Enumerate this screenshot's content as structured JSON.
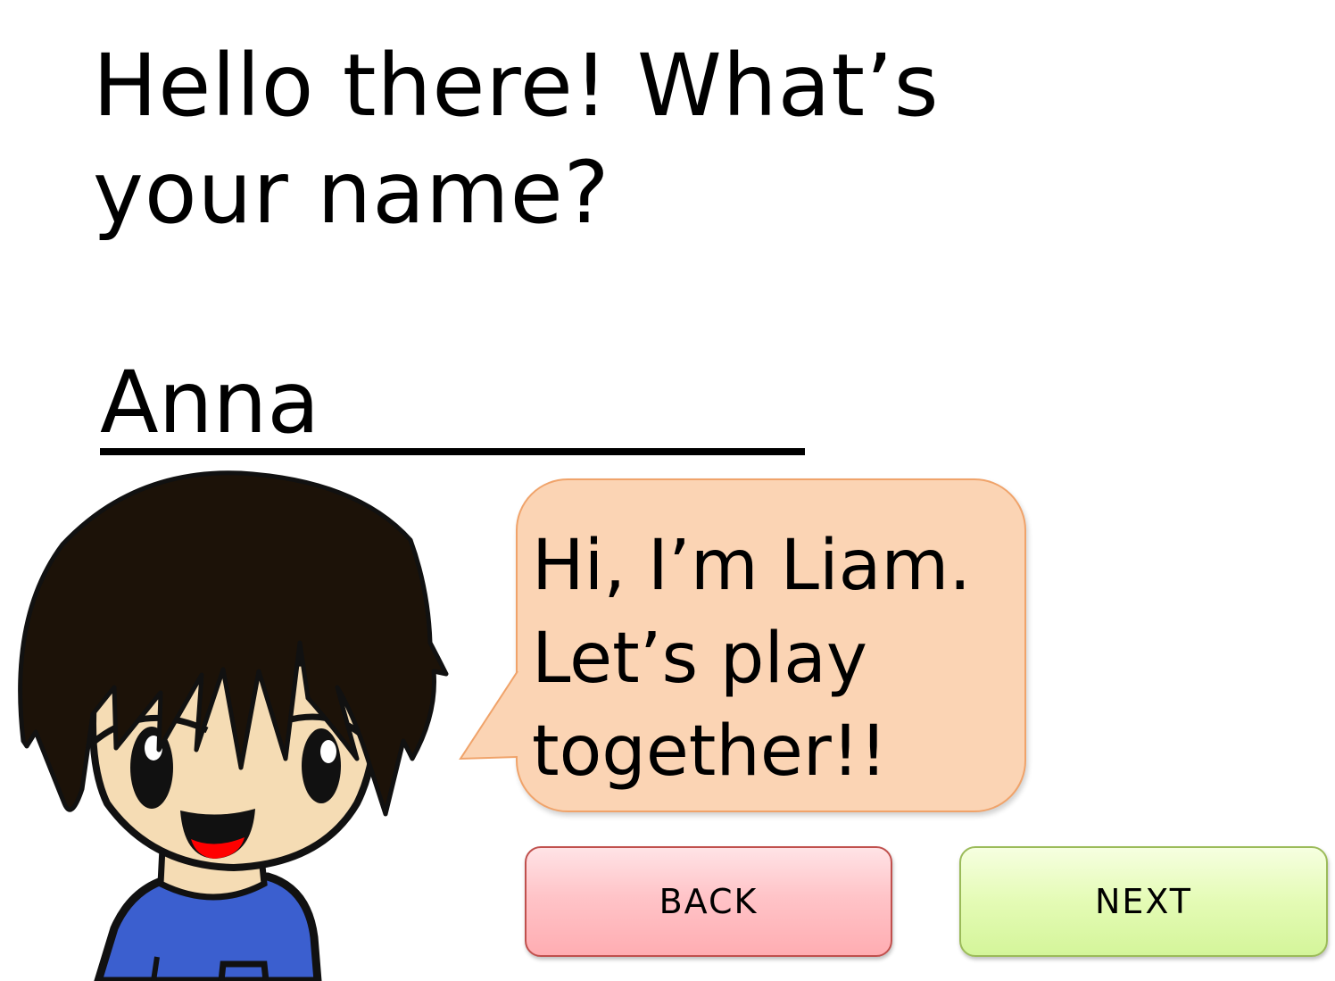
{
  "prompt": {
    "line1": "Hello there! What’s",
    "line2": "your name?"
  },
  "name_input": {
    "value": "Anna"
  },
  "speech_bubble": {
    "line1": "Hi, I’m Liam.",
    "line2": "Let’s play",
    "line3": "together!!",
    "fill_color": "#fbd4b4",
    "border_color": "#f0a36a"
  },
  "navigation": {
    "back_label": "BACK",
    "next_label": "NEXT",
    "back_color": "#ffc4c8",
    "next_color": "#e4fbb5"
  },
  "character": {
    "hair_color": "#1c1208",
    "skin_color": "#f5dcb4",
    "shirt_color": "#3b5fcf",
    "mouth_color": "#ff0000"
  }
}
